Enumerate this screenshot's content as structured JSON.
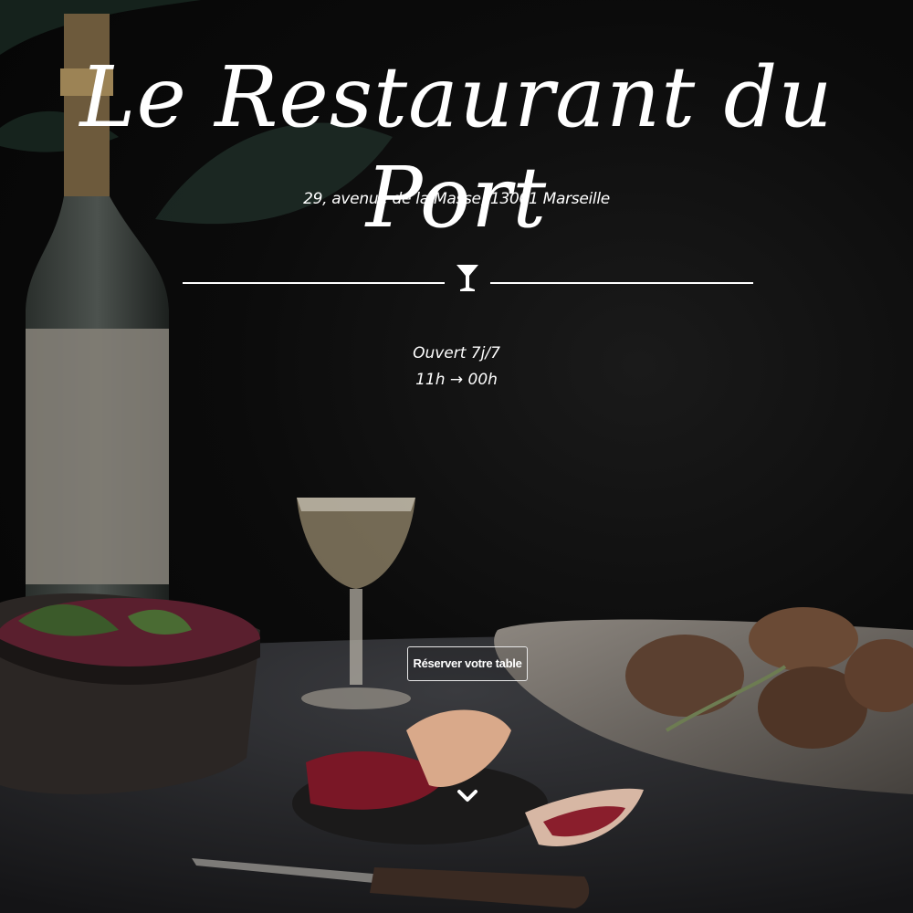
{
  "hero": {
    "title": "Le Restaurant du Port",
    "address": "29, avenue de la Masse, 13001 Marseille",
    "hours_line1": "Ouvert 7j/7",
    "hours_line2": "11h → 00h",
    "reserve_label": "Réserver votre table"
  },
  "icons": {
    "divider": "cocktail-glass-icon",
    "scroll": "chevron-down-icon"
  },
  "colors": {
    "text": "#ffffff",
    "background": "#050505"
  }
}
